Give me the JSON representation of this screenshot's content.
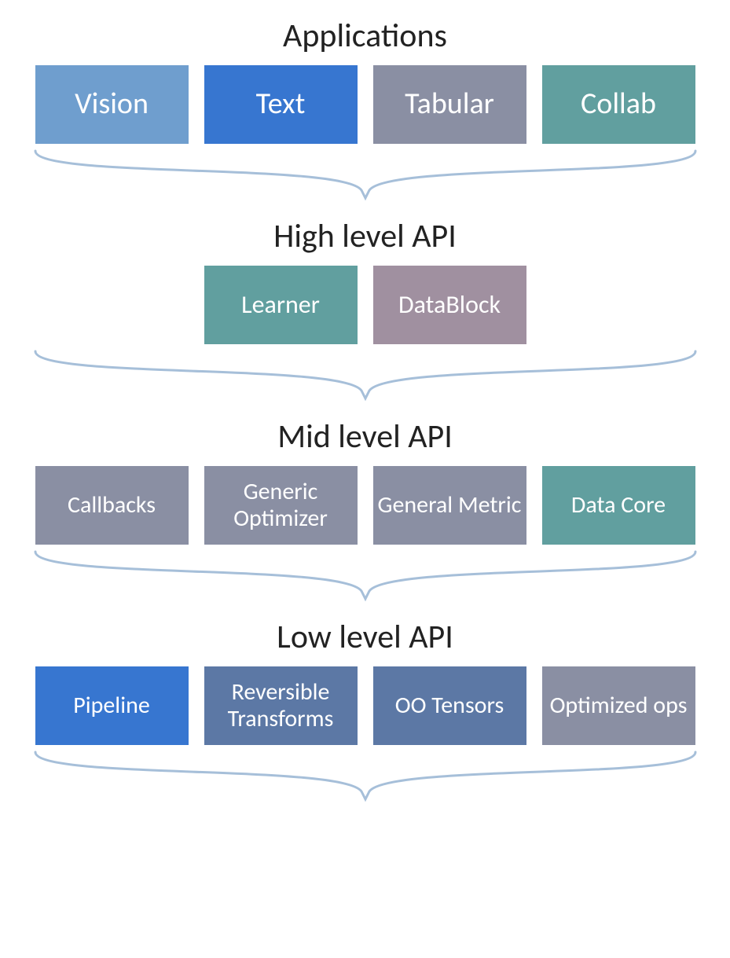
{
  "sections": {
    "applications": {
      "title": "Applications",
      "boxes": [
        {
          "label": "Vision",
          "color": "c-lightblue"
        },
        {
          "label": "Text",
          "color": "c-blue"
        },
        {
          "label": "Tabular",
          "color": "c-greyblue"
        },
        {
          "label": "Collab",
          "color": "c-teal"
        }
      ]
    },
    "high": {
      "title": "High level API",
      "boxes": [
        {
          "label": "Learner",
          "color": "c-teal"
        },
        {
          "label": "DataBlock",
          "color": "c-mauve"
        }
      ]
    },
    "mid": {
      "title": "Mid level API",
      "boxes": [
        {
          "label": "Callbacks",
          "color": "c-greyblue"
        },
        {
          "label": "Generic Optimizer",
          "color": "c-greyblue"
        },
        {
          "label": "General Metric",
          "color": "c-greyblue"
        },
        {
          "label": "Data Core",
          "color": "c-teal"
        }
      ]
    },
    "low": {
      "title": "Low level API",
      "boxes": [
        {
          "label": "Pipeline",
          "color": "c-blue"
        },
        {
          "label": "Reversible Transforms",
          "color": "c-steel"
        },
        {
          "label": "OO Tensors",
          "color": "c-steel"
        },
        {
          "label": "Optimized ops",
          "color": "c-greyblue"
        }
      ]
    }
  },
  "colors": {
    "bracket_stroke": "#a6bfd9"
  }
}
